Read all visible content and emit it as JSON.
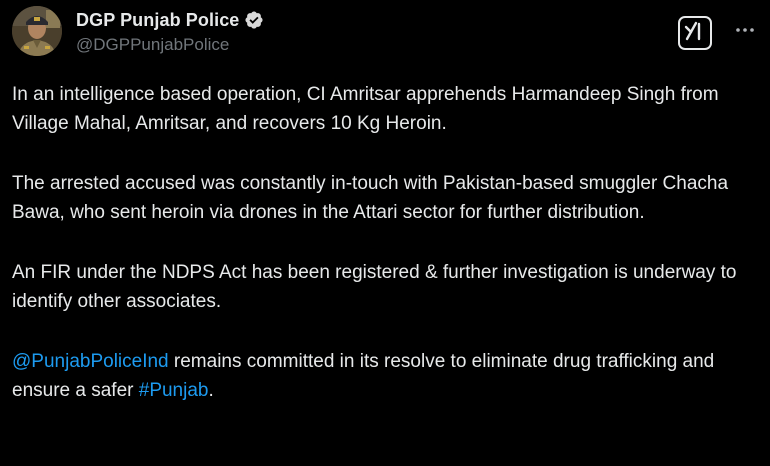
{
  "author": {
    "display_name": "DGP Punjab Police",
    "handle": "@DGPPunjabPolice",
    "verified": true,
    "verified_badge_color": "#d9d9d9",
    "avatar_icon": "police-officer-avatar"
  },
  "actions": {
    "grok_icon": "grok-icon",
    "more_icon": "more-dots-icon"
  },
  "tweet": {
    "paragraph_1": "In an intelligence based operation, CI Amritsar apprehends Harmandeep Singh from Village Mahal, Amritsar, and recovers 10 Kg Heroin.",
    "paragraph_2": "The arrested accused was constantly in-touch with Pakistan-based smuggler Chacha Bawa, who sent heroin via drones in the Attari sector for further distribution.",
    "paragraph_3": "An FIR under the NDPS Act has been registered & further investigation is underway to identify other associates.",
    "paragraph_4": {
      "mention": "@PunjabPoliceInd",
      "text_1": " remains committed in its resolve to eliminate drug trafficking and ensure a safer ",
      "hashtag": "#Punjab",
      "text_2": "."
    }
  },
  "colors": {
    "background": "#000000",
    "text": "#e7e9ea",
    "secondary_text": "#71767b",
    "link": "#1d9bf0"
  }
}
